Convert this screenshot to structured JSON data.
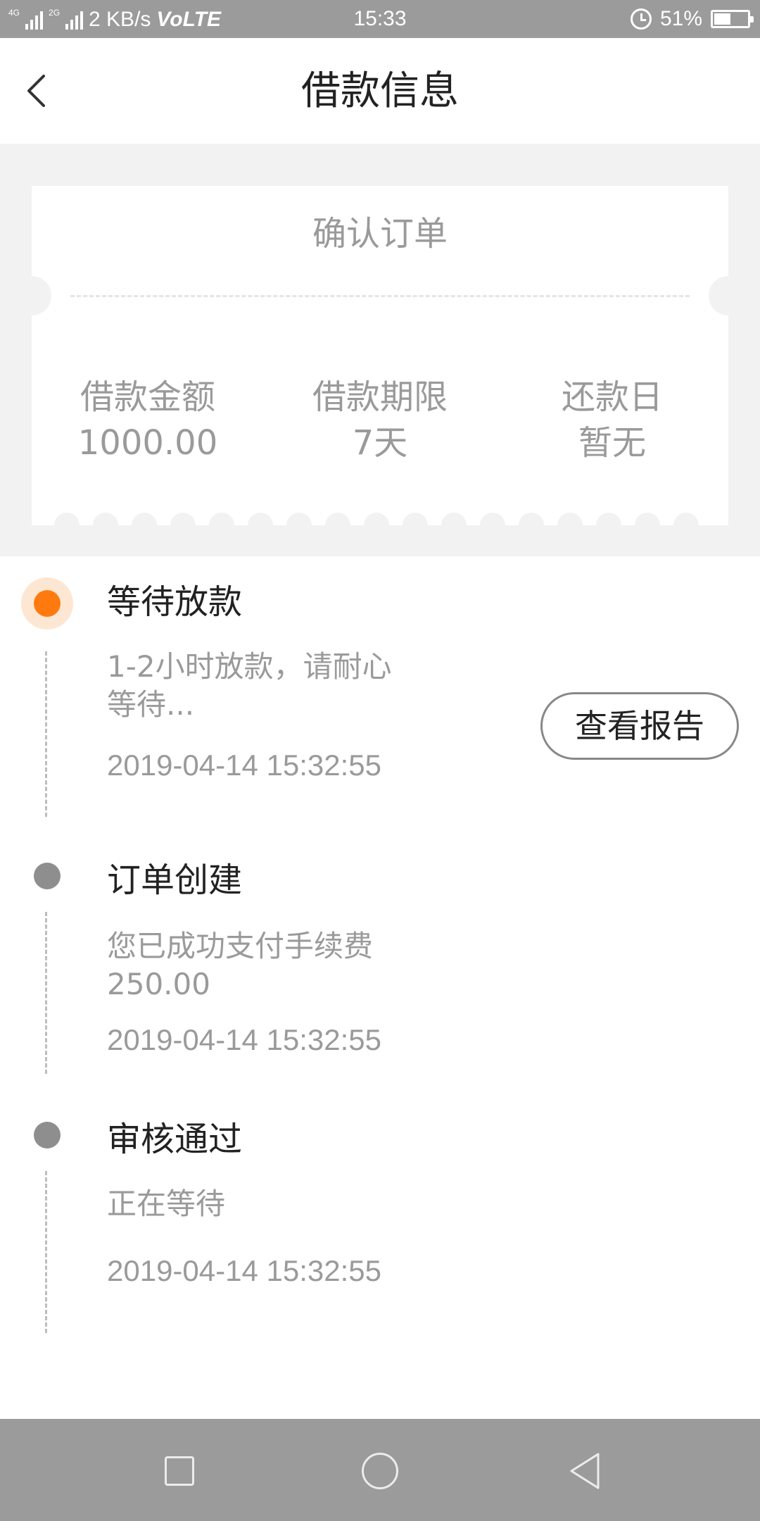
{
  "status_bar": {
    "net_tag_1": "4G",
    "net_tag_2": "2G",
    "speed": "2 KB/s",
    "volte": "VoLTE",
    "time": "15:33",
    "battery_percent": "51%",
    "battery_level": 0.51,
    "icons": [
      "signal-icon",
      "alarm-icon",
      "battery-icon"
    ]
  },
  "header": {
    "title": "借款信息",
    "back_icon": "chevron-left-icon"
  },
  "ticket": {
    "title": "确认订单",
    "columns": [
      {
        "label": "借款金额",
        "value": "1000.00"
      },
      {
        "label": "借款期限",
        "value": "7天"
      },
      {
        "label": "还款日",
        "value": "暂无"
      }
    ]
  },
  "timeline": {
    "items": [
      {
        "title": "等待放款",
        "desc": "1-2小时放款，请耐心等待...",
        "time": "2019-04-14 15:32:55",
        "active": true
      },
      {
        "title": "订单创建",
        "desc": "您已成功支付手续费250.00",
        "time": "2019-04-14 15:32:55",
        "active": false
      },
      {
        "title": "审核通过",
        "desc": "正在等待",
        "time": "2019-04-14 15:32:55",
        "active": false
      }
    ],
    "report_button": "查看报告"
  },
  "colors": {
    "accent": "#ff7a0e",
    "accent_halo": "#fde7d3",
    "inactive_dot": "#8e8e8e",
    "muted_text": "#9a9a9a",
    "status_bar": "#9b9b9b"
  },
  "nav_bar": {
    "icons": [
      "square-icon",
      "circle-icon",
      "triangle-back-icon"
    ]
  }
}
